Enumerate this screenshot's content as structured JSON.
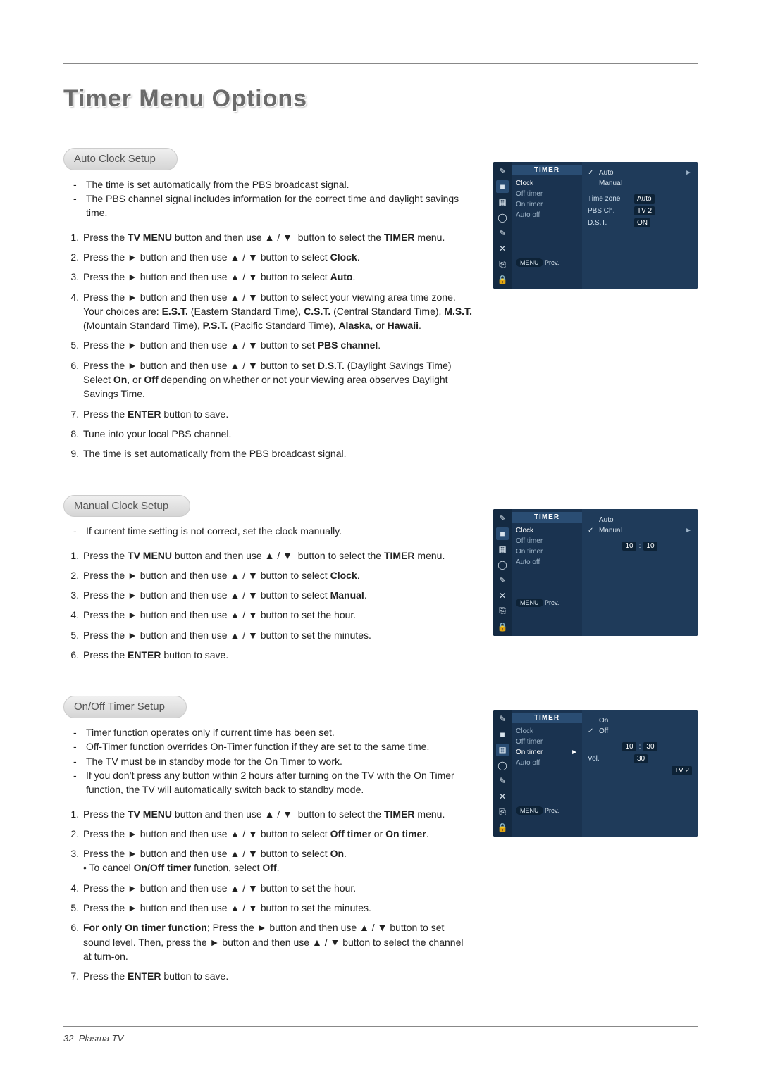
{
  "page": {
    "title": "Timer Menu Options",
    "footer_page": "32",
    "footer_product": "Plasma TV"
  },
  "glyphs": {
    "up": "▲",
    "down": "▼",
    "right": "►",
    "check": "✓"
  },
  "sections": {
    "auto": {
      "header": "Auto Clock Setup",
      "bullets": [
        "The time is set automatically from the PBS broadcast signal.",
        "The PBS channel signal includes information for the correct time and daylight savings time."
      ],
      "steps_a": "Press the ",
      "s1_b": "TV MENU",
      "s1_c": " button and then use ",
      "s1_d": " button to select the ",
      "s1_e": "TIMER",
      "s1_f": " menu.",
      "s2_a": "Press the ",
      "s2_b": " button and then use ",
      "s2_c": " button to select ",
      "s2_d": "Clock",
      "s3_d": "Auto",
      "s4_a": "Press the ",
      "s4_b": " button and then use ",
      "s4_c": " button to select your viewing area time zone. Your choices are: ",
      "s4_est": "E.S.T.",
      "s4_est_t": " (Eastern Standard Time), ",
      "s4_cst": "C.S.T.",
      "s4_cst_t": " (Central Standard Time), ",
      "s4_mst": "M.S.T.",
      "s4_mst_t": " (Mountain  Standard Time), ",
      "s4_pst": "P.S.T.",
      "s4_pst_t": " (Pacific Standard Time), ",
      "s4_ak": "Alaska",
      "s4_or": ", or ",
      "s4_hi": "Hawaii",
      "s5_a": "Press the ",
      "s5_b": " button and then use ",
      "s5_c": " button to set ",
      "s5_d": "PBS channel",
      "s6_a": "Press the ",
      "s6_b": " button and then use ",
      "s6_c": " button to set ",
      "s6_d": "D.S.T.",
      "s6_e": " (Daylight Savings Time) Select ",
      "s6_on": "On",
      "s6_or": ", or ",
      "s6_off": "Off",
      "s6_f": " depending on whether or not your viewing area observes Daylight Savings Time.",
      "s7_a": "Press the ",
      "s7_b": "ENTER",
      "s7_c": " button to save.",
      "s8": "Tune into your local PBS channel.",
      "s9": "The time is set automatically from the PBS broadcast signal."
    },
    "manual": {
      "header": "Manual Clock Setup",
      "bullets": [
        "If current time setting is not correct, set the clock manually."
      ],
      "s3_d": "Manual",
      "s4_c": " button to set the hour.",
      "s5_c": " button to set the minutes."
    },
    "onoff": {
      "header": "On/Off Timer Setup",
      "bullets": [
        "Timer function operates only if current time has been set.",
        "Off-Timer function overrides On-Timer function if they are set to the same time.",
        "The TV must be in standby mode for the On Timer to work.",
        "If you don’t press any button within 2 hours after turning on the TV with the On Timer function, the TV will automatically switch back to standby mode."
      ],
      "s2_d1": "Off timer",
      "s2_or": " or ",
      "s2_d2": "On timer",
      "s3_d": "On",
      "s3_sub_a": "• To cancel ",
      "s3_sub_b": "On/Off timer",
      "s3_sub_c": " function, select ",
      "s3_sub_d": "Off",
      "s6_a": "For only ",
      "s6_b": "On timer",
      "s6_c": " function",
      "s6_d": "; Press the ",
      "s6_e": " button and then use ",
      "s6_f": " button to set sound level. Then, press the ",
      "s6_g": " button and then use ",
      "s6_h": " button to select the channel at turn-on."
    }
  },
  "osd_menu": {
    "header": "TIMER",
    "items": [
      "Clock",
      "Off timer",
      "On timer",
      "Auto off"
    ],
    "footer_menu": "MENU",
    "footer_prev": "Prev."
  },
  "osd1": {
    "auto": "Auto",
    "manual": "Manual",
    "timezone": "Time zone",
    "timezone_val": "Auto",
    "pbs": "PBS Ch.",
    "pbs_val": "TV 2",
    "dst": "D.S.T.",
    "dst_val": "ON"
  },
  "osd2": {
    "auto": "Auto",
    "manual": "Manual",
    "hour": "10",
    "min": "10"
  },
  "osd3": {
    "on": "On",
    "off": "Off",
    "hour": "10",
    "min": "30",
    "vol": "Vol.",
    "vol_val": "30",
    "ch_val": "TV  2"
  },
  "icons": [
    "✎",
    "■",
    "▦",
    "◯",
    "✎",
    "✕",
    "⎘",
    "🔒"
  ]
}
